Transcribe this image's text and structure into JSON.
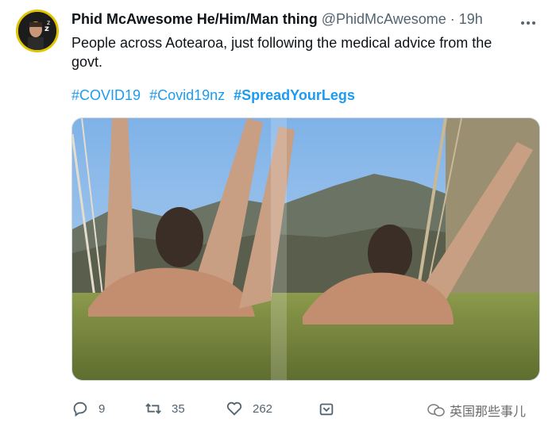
{
  "tweet": {
    "author_name": "Phid McAwesome He/Him/Man thing",
    "handle": "@PhidMcAwesome",
    "separator": "·",
    "time": "19h",
    "text": "People across Aotearoa, just following the medical advice from the govt.",
    "hashtags": [
      "#COVID19",
      "#Covid19nz",
      "#SpreadYourLegs"
    ]
  },
  "actions": {
    "replies": "9",
    "retweets": "35",
    "likes": "262"
  },
  "watermark": {
    "text": "英国那些事儿"
  },
  "icons": {
    "more": "more-icon",
    "reply": "reply-icon",
    "retweet": "retweet-icon",
    "like": "heart-icon",
    "share": "share-icon"
  },
  "colors": {
    "link": "#1d9bf0",
    "secondary": "#536471",
    "avatar_ring": "#e0c400"
  }
}
